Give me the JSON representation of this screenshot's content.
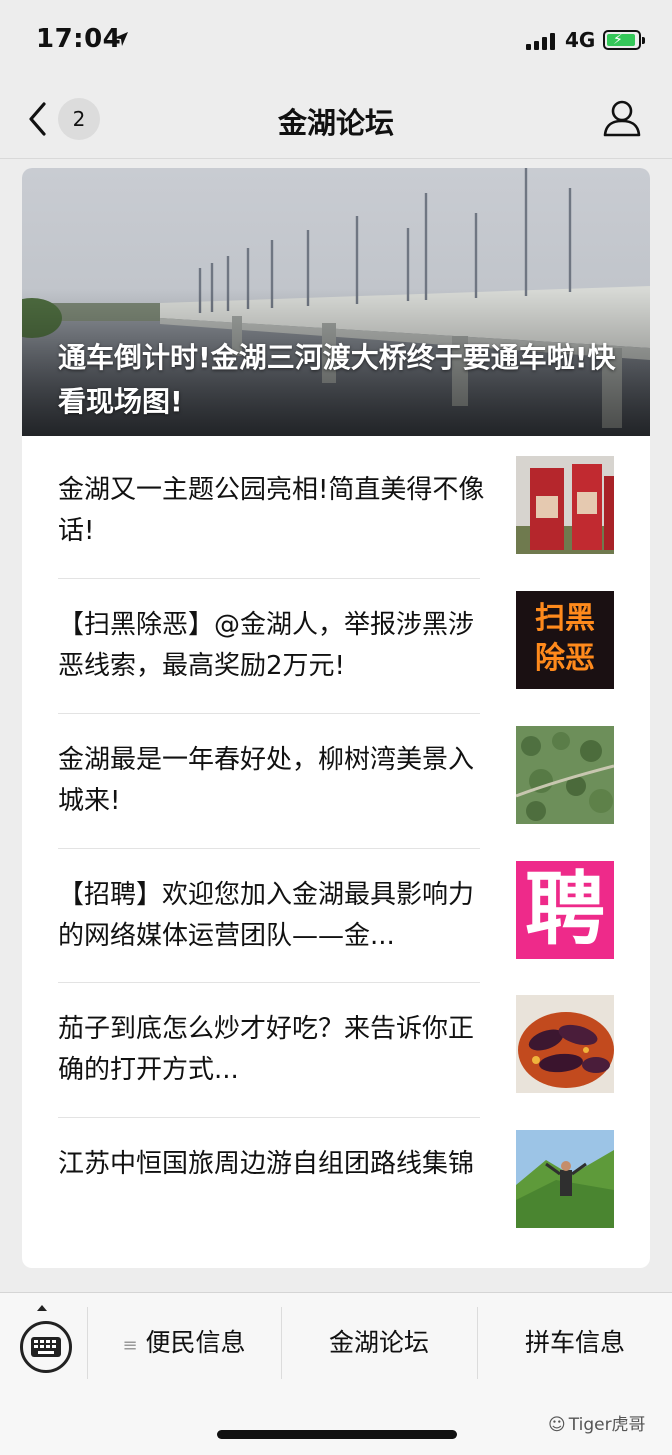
{
  "status": {
    "time": "17:04",
    "network": "4G"
  },
  "nav": {
    "badge": "2",
    "title": "金湖论坛"
  },
  "hero": {
    "title": "通车倒计时!金湖三河渡大桥终于要通车啦!快看现场图!"
  },
  "articles": [
    {
      "title": "金湖又一主题公园亮相!简直美得不像话!"
    },
    {
      "title": "【扫黑除恶】@金湖人，举报涉黑涉恶线索，最高奖励2万元!"
    },
    {
      "title": "金湖最是一年春好处，柳树湾美景入城来!"
    },
    {
      "title": "【招聘】欢迎您加入金湖最具影响力的网络媒体运营团队——金..."
    },
    {
      "title": "茄子到底怎么炒才好吃？来告诉你正确的打开方式..."
    },
    {
      "title": "江苏中恒国旅周边游自组团路线集锦"
    }
  ],
  "thumb_text": {
    "sao": "扫黑",
    "chu": "除恶",
    "pin": "聘"
  },
  "menu": {
    "item1": "便民信息",
    "item2": "金湖论坛",
    "item3": "拼车信息"
  },
  "watermark": "Tiger虎哥",
  "colors": {
    "accent": "#35c759",
    "pin_bg": "#ee2a8a"
  }
}
